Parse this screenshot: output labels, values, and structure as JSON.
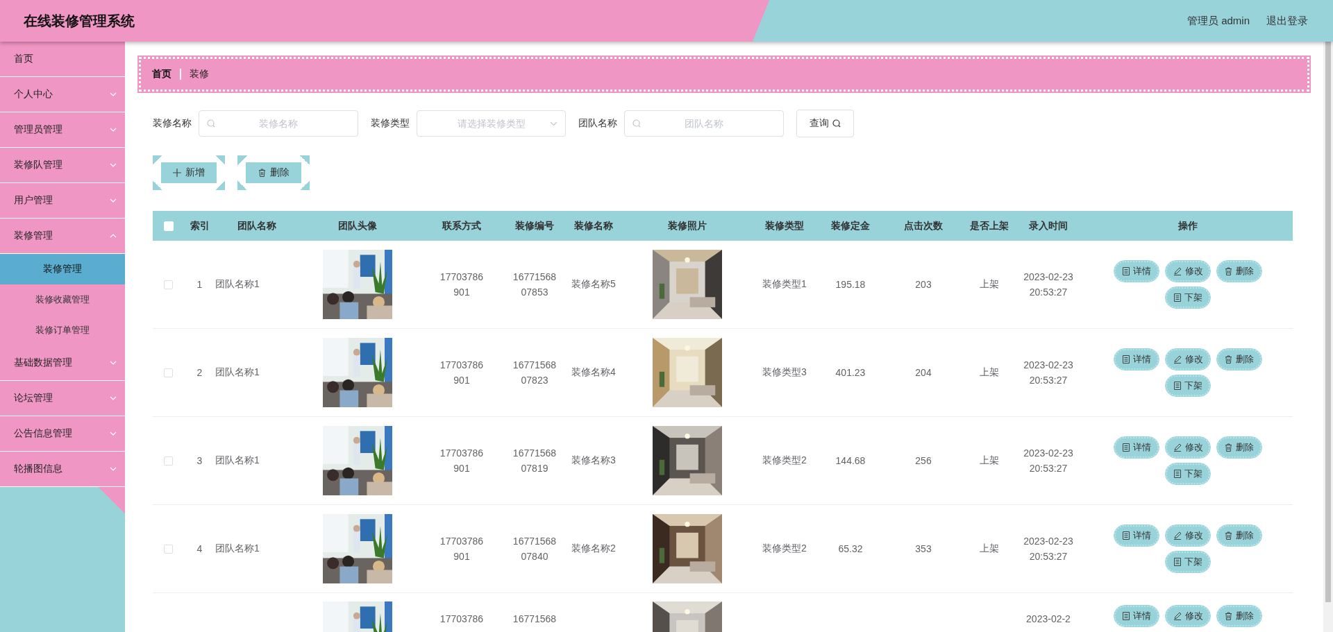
{
  "header": {
    "title": "在线装修管理系统",
    "user": "管理员 admin",
    "logout": "退出登录"
  },
  "sidebar": {
    "items": [
      {
        "label": "首页",
        "kind": "link",
        "selected": false
      },
      {
        "label": "个人中心",
        "kind": "menu",
        "expanded": false
      },
      {
        "label": "管理员管理",
        "kind": "menu",
        "expanded": false
      },
      {
        "label": "装修队管理",
        "kind": "menu",
        "expanded": false
      },
      {
        "label": "用户管理",
        "kind": "menu",
        "expanded": false
      },
      {
        "label": "装修管理",
        "kind": "menu",
        "expanded": true,
        "children": [
          {
            "label": "装修管理",
            "selected": true
          },
          {
            "label": "装修收藏管理",
            "selected": false
          },
          {
            "label": "装修订单管理",
            "selected": false
          }
        ]
      },
      {
        "label": "基础数据管理",
        "kind": "menu",
        "expanded": false
      },
      {
        "label": "论坛管理",
        "kind": "menu",
        "expanded": false
      },
      {
        "label": "公告信息管理",
        "kind": "menu",
        "expanded": false
      },
      {
        "label": "轮播图信息",
        "kind": "menu",
        "expanded": false
      }
    ]
  },
  "breadcrumb": [
    "首页",
    "装修"
  ],
  "search": {
    "fields": [
      {
        "label": "装修名称",
        "kind": "input",
        "placeholder": "装修名称"
      },
      {
        "label": "装修类型",
        "kind": "select",
        "placeholder": "请选择装修类型"
      },
      {
        "label": "团队名称",
        "kind": "input",
        "placeholder": "团队名称"
      }
    ],
    "button": "查询"
  },
  "actions": [
    {
      "label": "新增",
      "kind": "add"
    },
    {
      "label": "删除",
      "kind": "delete"
    }
  ],
  "table": {
    "header_checked": false,
    "columns": [
      "索引",
      "团队名称",
      "团队头像",
      "联系方式",
      "装修编号",
      "装修名称",
      "装修照片",
      "装修类型",
      "装修定金",
      "点击次数",
      "是否上架",
      "录入时间",
      "操作"
    ],
    "rows": [
      {
        "checked": false,
        "index": "1",
        "team": "团队名称1",
        "contact": "17703786901",
        "number": "1677156807853",
        "name": "装修名称5",
        "type": "装修类型1",
        "deposit": "195.18",
        "clicks": "203",
        "listed": "上架",
        "time": "2023-02-23 20:53:27",
        "buttons": [
          {
            "label": "详情",
            "kind": "detail"
          },
          {
            "label": "修改",
            "kind": "edit"
          },
          {
            "label": "删除",
            "kind": "delete"
          },
          {
            "label": "下架",
            "kind": "detail"
          }
        ]
      },
      {
        "checked": false,
        "index": "2",
        "team": "团队名称1",
        "contact": "17703786901",
        "number": "1677156807823",
        "name": "装修名称4",
        "type": "装修类型3",
        "deposit": "401.23",
        "clicks": "204",
        "listed": "上架",
        "time": "2023-02-23 20:53:27",
        "buttons": [
          {
            "label": "详情",
            "kind": "detail"
          },
          {
            "label": "修改",
            "kind": "edit"
          },
          {
            "label": "删除",
            "kind": "delete"
          },
          {
            "label": "下架",
            "kind": "detail"
          }
        ]
      },
      {
        "checked": false,
        "index": "3",
        "team": "团队名称1",
        "contact": "17703786901",
        "number": "1677156807819",
        "name": "装修名称3",
        "type": "装修类型2",
        "deposit": "144.68",
        "clicks": "256",
        "listed": "上架",
        "time": "2023-02-23 20:53:27",
        "buttons": [
          {
            "label": "详情",
            "kind": "detail"
          },
          {
            "label": "修改",
            "kind": "edit"
          },
          {
            "label": "删除",
            "kind": "delete"
          },
          {
            "label": "下架",
            "kind": "detail"
          }
        ]
      },
      {
        "checked": false,
        "index": "4",
        "team": "团队名称1",
        "contact": "17703786901",
        "number": "1677156807840",
        "name": "装修名称2",
        "type": "装修类型2",
        "deposit": "65.32",
        "clicks": "353",
        "listed": "上架",
        "time": "2023-02-23 20:53:27",
        "buttons": [
          {
            "label": "详情",
            "kind": "detail"
          },
          {
            "label": "修改",
            "kind": "edit"
          },
          {
            "label": "删除",
            "kind": "delete"
          },
          {
            "label": "下架",
            "kind": "detail"
          }
        ]
      },
      {
        "contact": "17703786",
        "number": "16771568",
        "time": "2023-02-2",
        "buttons": [
          {
            "label": "详情",
            "kind": "detail"
          },
          {
            "label": "修改",
            "kind": "edit"
          },
          {
            "label": "删除",
            "kind": "delete"
          }
        ]
      }
    ]
  }
}
